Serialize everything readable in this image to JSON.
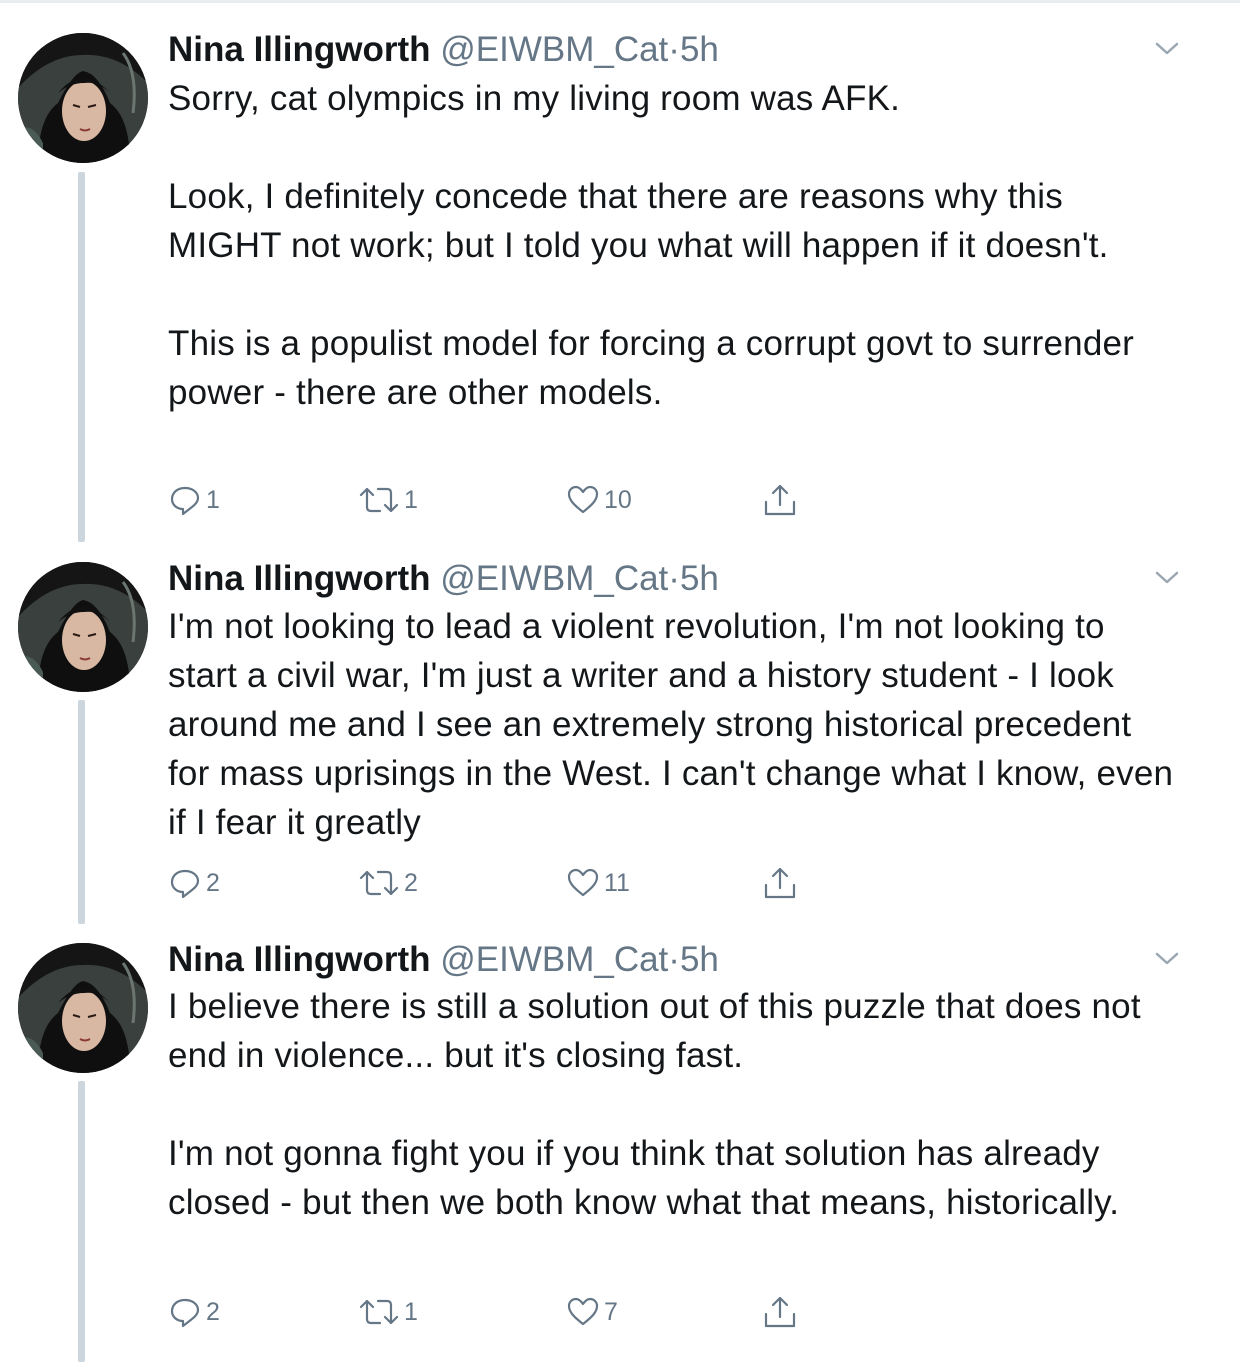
{
  "tweets": [
    {
      "author_name": "Nina Illingworth",
      "handle": "@EIWBM_Cat",
      "separator": "·",
      "time": "5h",
      "text": "Sorry, cat olympics in my living room was AFK.\n\nLook, I definitely concede that there are reasons why this MIGHT not work; but I told you what will happen if it doesn't.\n\nThis is a populist model for forcing a corrupt govt to surrender power - there are other models.",
      "replies": "1",
      "retweets": "1",
      "likes": "10"
    },
    {
      "author_name": "Nina Illingworth",
      "handle": "@EIWBM_Cat",
      "separator": "·",
      "time": "5h",
      "text": "I'm not looking to lead a violent revolution, I'm not looking to start a civil war, I'm just a writer and a history student - I look around me and I see an extremely strong historical precedent for mass uprisings in the West. I can't change what I know, even if I fear it greatly",
      "replies": "2",
      "retweets": "2",
      "likes": "11"
    },
    {
      "author_name": "Nina Illingworth",
      "handle": "@EIWBM_Cat",
      "separator": "·",
      "time": "5h",
      "text": "I believe there is still a solution out of this puzzle that does not end in violence... but it's closing fast.\n\nI'm not gonna fight you if you think that solution has already closed - but then we both know what that means, historically.",
      "replies": "2",
      "retweets": "1",
      "likes": "7"
    }
  ],
  "icons": {
    "avatar": "avatar-image",
    "caret": "chevron-down-icon",
    "reply": "reply-icon",
    "retweet": "retweet-icon",
    "like": "heart-icon",
    "share": "share-icon"
  },
  "colors": {
    "text": "#14171a",
    "secondary": "#657786",
    "thread_line": "#cdd6dd",
    "border": "#e6ecf0",
    "background": "#ffffff"
  }
}
